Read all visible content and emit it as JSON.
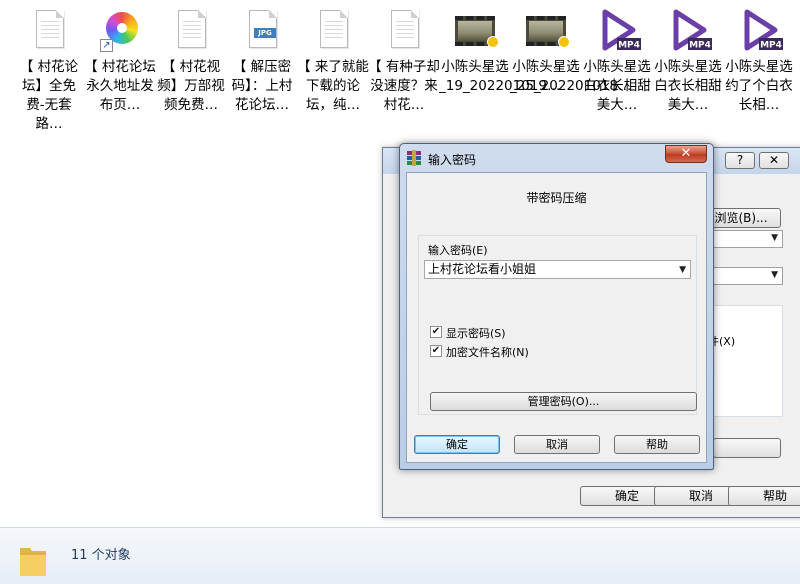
{
  "files": [
    {
      "icon": "text-file-icon",
      "label": "【 村花论坛】全免费-无套路…"
    },
    {
      "icon": "shortcut-flower-icon",
      "label": "【 村花论坛永久地址发布页…"
    },
    {
      "icon": "text-file-icon",
      "label": "【 村花视频】万部视频免费…"
    },
    {
      "icon": "jpg-file-icon",
      "label": "【 解压密码】：上村花论坛…"
    },
    {
      "icon": "text-file-icon",
      "label": "【 来了就能下载的论坛，纯…"
    },
    {
      "icon": "text-file-icon",
      "label": "【 有种子却没速度？来村花…"
    },
    {
      "icon": "video-thumbnail-icon",
      "label": "小陈头星选_19_202201019…"
    },
    {
      "icon": "video-thumbnail-icon",
      "label": "小陈头星选_25_202201018…"
    },
    {
      "icon": "mp4-file-icon",
      "label": "小陈头星选白衣长相甜美大…"
    },
    {
      "icon": "mp4-file-icon",
      "label": "小陈头星选白衣长相甜美大…"
    },
    {
      "icon": "mp4-file-icon",
      "label": "小陈头星选约了个白衣长相…"
    }
  ],
  "jpg_tag": "JPG",
  "mp4_tag": "MP4",
  "back_dialog": {
    "help_button": "?",
    "close_button": "✕",
    "browse_button": "浏览(B)...",
    "partial_checkbox_label": "件(X)",
    "ok_button": "确定",
    "cancel_button": "取消",
    "help_label_button": "帮助"
  },
  "password_dialog": {
    "title": "输入密码",
    "close_glyph": "✕",
    "profile_label": "带密码压缩",
    "password_label": "输入密码(E)",
    "password_value": "上村花论坛看小姐姐",
    "show_password_label": "显示密码(S)",
    "show_password_checked": true,
    "encrypt_names_label": "加密文件名称(N)",
    "encrypt_names_checked": true,
    "manage_button": "管理密码(O)...",
    "ok_button": "确定",
    "cancel_button": "取消",
    "help_button": "帮助"
  },
  "status_bar": {
    "text": "11 个对象"
  },
  "colors": {
    "mp4_accent": "#6b3fa8",
    "title_close": "#c74c32"
  }
}
